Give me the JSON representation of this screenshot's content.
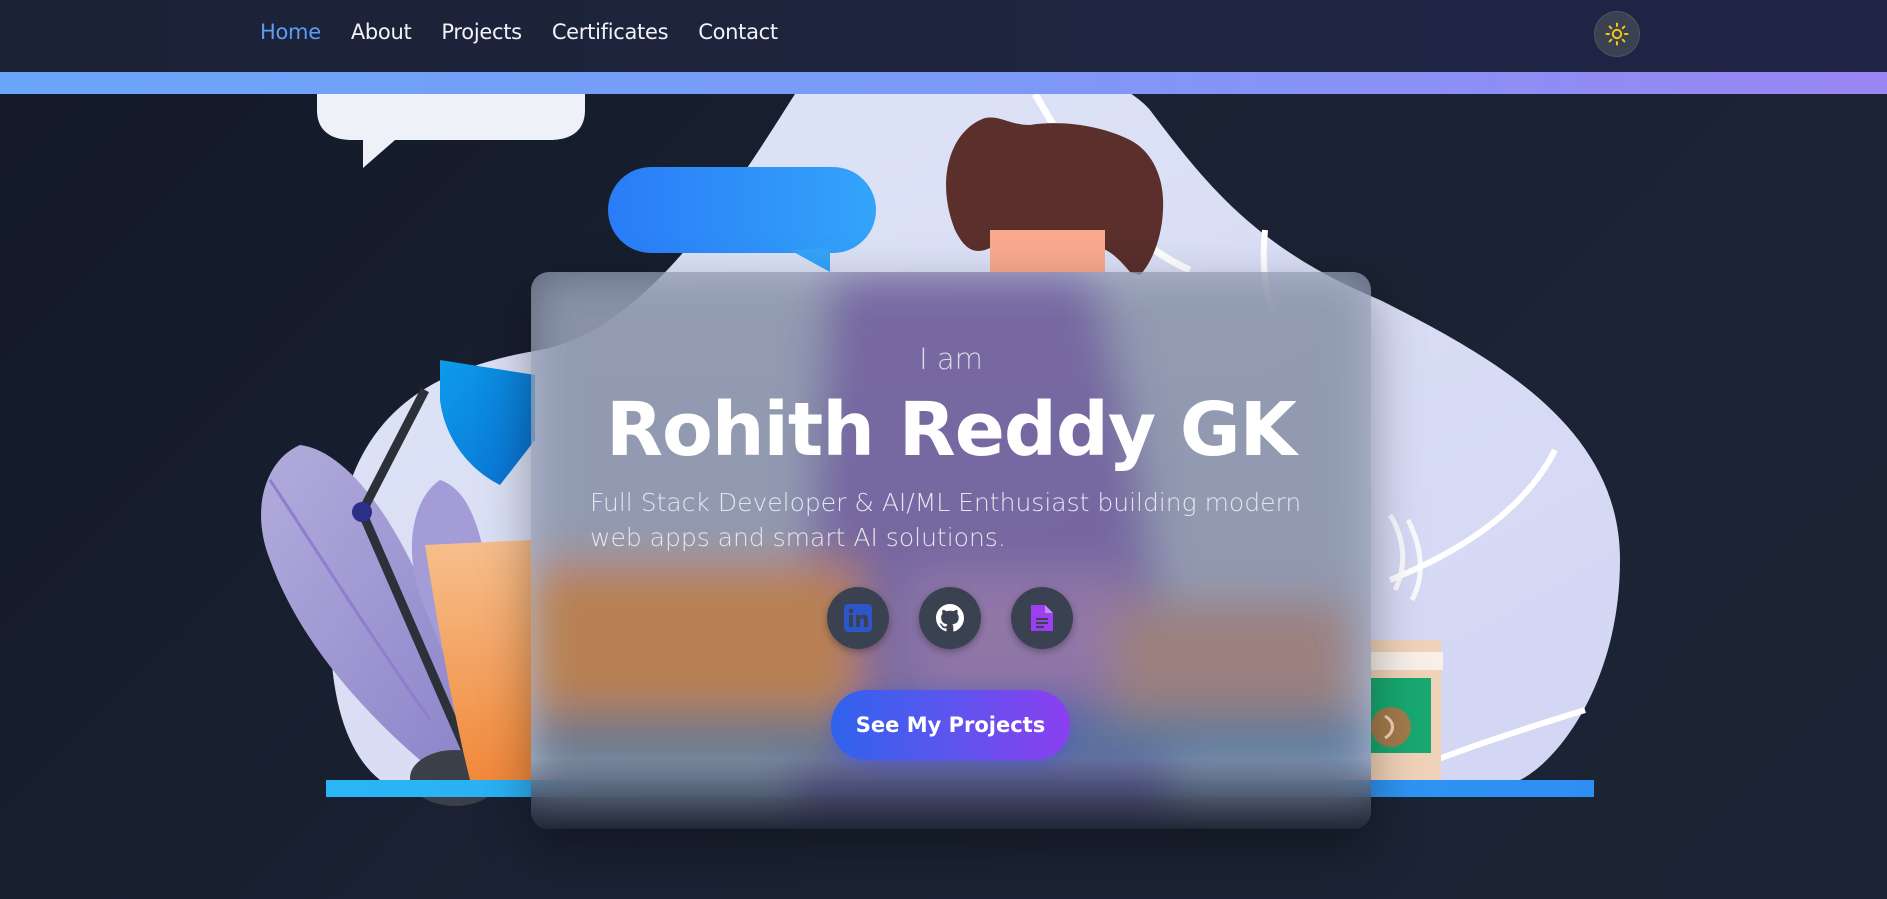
{
  "nav": {
    "items": [
      {
        "label": "Home",
        "active": true
      },
      {
        "label": "About",
        "active": false
      },
      {
        "label": "Projects",
        "active": false
      },
      {
        "label": "Certificates",
        "active": false
      },
      {
        "label": "Contact",
        "active": false
      }
    ],
    "theme_toggle_icon": "sun-icon"
  },
  "hero": {
    "greeting": "I am",
    "name": "Rohith Reddy GK",
    "tagline": "Full Stack Developer & AI/ML Enthusiast building modern web apps and smart AI solutions.",
    "socials": [
      {
        "icon": "linkedin-icon"
      },
      {
        "icon": "github-icon"
      },
      {
        "icon": "document-icon"
      }
    ],
    "cta_label": "See My Projects"
  },
  "colors": {
    "accent_blue": "#5b9cf5",
    "cta_start": "#2f63ec",
    "cta_end": "#8b3ff0",
    "sun": "#f5c518"
  }
}
